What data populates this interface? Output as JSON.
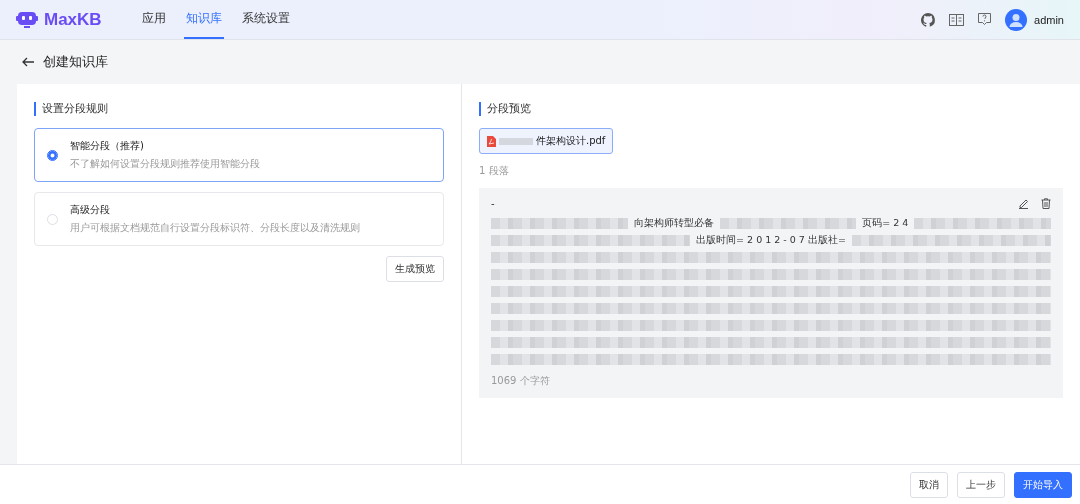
{
  "nav": {
    "brand": "MaxKB",
    "tabs": [
      {
        "label": "应用",
        "selected": false
      },
      {
        "label": "知识库",
        "selected": true
      },
      {
        "label": "系统设置",
        "selected": false
      }
    ],
    "user": "admin"
  },
  "page": {
    "title": "创建知识库"
  },
  "rules": {
    "heading": "设置分段规则",
    "options": [
      {
        "title": "智能分段（推荐)",
        "description": "不了解如何设置分段规则推荐使用智能分段",
        "selected": true
      },
      {
        "title": "高级分段",
        "description": "用户可根据文档规范自行设置分段标识符、分段长度以及清洗规则",
        "selected": false
      }
    ],
    "button": "生成预览"
  },
  "preview": {
    "heading": "分段预览",
    "files": [
      {
        "name": "件架构设计.pdf",
        "selected": true
      }
    ],
    "count": "1 段落",
    "segments": [
      {
        "title": "-",
        "lines": [
          [
            {
              "kind": "blur"
            },
            {
              "kind": "text",
              "text": "向架构师转型必备"
            },
            {
              "kind": "blur"
            },
            {
              "kind": "text",
              "text": "页码= 2 4"
            },
            {
              "kind": "blur"
            }
          ],
          [
            {
              "kind": "blur"
            },
            {
              "kind": "text",
              "text": "出版时间= 2 0 1 2 - 0 7 出版社="
            },
            {
              "kind": "blur"
            }
          ],
          [
            {
              "kind": "blur"
            }
          ],
          [
            {
              "kind": "blur"
            }
          ],
          [
            {
              "kind": "blur"
            }
          ],
          [
            {
              "kind": "blur"
            }
          ],
          [
            {
              "kind": "blur"
            }
          ],
          [
            {
              "kind": "blur"
            }
          ],
          [
            {
              "kind": "blur"
            }
          ]
        ],
        "chars": "1069 个字符"
      }
    ]
  },
  "footer": {
    "buttons": [
      {
        "label": "取消",
        "kind": "default"
      },
      {
        "label": "上一步",
        "kind": "default"
      },
      {
        "label": "开始导入",
        "kind": "primary"
      }
    ]
  }
}
